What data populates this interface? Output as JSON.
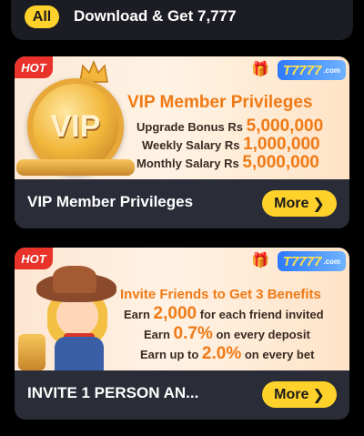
{
  "top": {
    "all_label": "All",
    "title": "Download & Get 7,777"
  },
  "cards": [
    {
      "hot": "HOT",
      "brand": "T7777",
      "brand_suffix": ".com",
      "heading": "VIP Member Privileges",
      "lines": [
        {
          "label": "Upgrade Bonus Rs",
          "value": "5,000,000"
        },
        {
          "label": "Weekly Salary Rs",
          "value": "1,000,000"
        },
        {
          "label": "Monthly Salary Rs",
          "value": "5,000,000"
        }
      ],
      "coin_text": "VIP",
      "title": "VIP Member Privileges",
      "button": "More"
    },
    {
      "hot": "HOT",
      "brand": "T7777",
      "brand_suffix": ".com",
      "heading": "Invite Friends to Get 3 Benefits",
      "lines": [
        {
          "pre": "Earn",
          "value": "2,000",
          "post": "for each friend invited"
        },
        {
          "pre": "Earn",
          "value": "0.7%",
          "post": "on every deposit"
        },
        {
          "pre": "Earn up to",
          "value": "2.0%",
          "post": "on every bet"
        }
      ],
      "title": "INVITE 1 PERSON AN...",
      "button": "More"
    }
  ],
  "colors": {
    "accent": "#ffd22b",
    "card_bg": "#2a2c37",
    "orange": "#ef7a16"
  }
}
